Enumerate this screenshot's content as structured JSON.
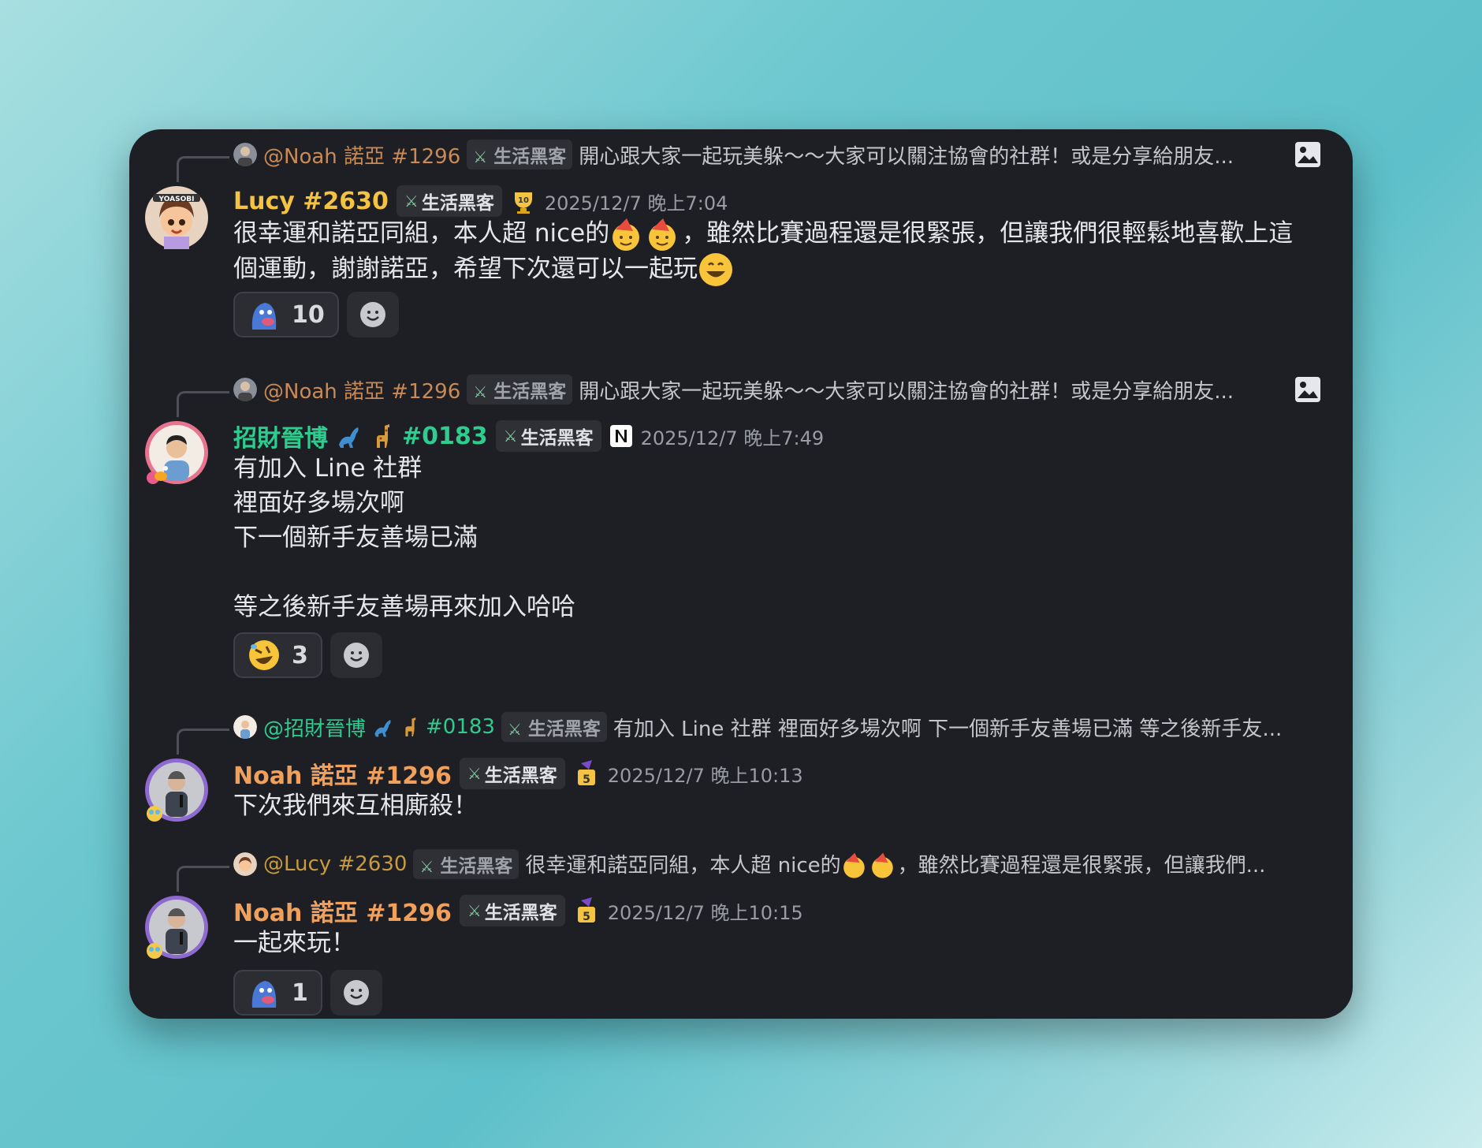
{
  "messages": [
    {
      "reply": {
        "name": "@Noah 諾亞 #1296",
        "badge": "生活黑客",
        "text": "開心跟大家一起玩美躲～～大家可以關注協會的社群！或是分享給朋友..."
      },
      "author": "Lucy #2630",
      "author_color": "#f5c342",
      "badge": "生活黑客",
      "timestamp": "2025/12/7 晚上7:04",
      "body_1": "很幸運和諾亞同組，本人超 nice的",
      "body_2": "，雖然比賽過程還是很緊張，但讓我們很輕鬆地喜歡上這",
      "body_3": "個運動，謝謝諾亞，希望下次還可以一起玩",
      "reaction_count": "10"
    },
    {
      "reply": {
        "name": "@Noah 諾亞 #1296",
        "badge": "生活黑客",
        "text": "開心跟大家一起玩美躲～～大家可以關注協會的社群！或是分享給朋友..."
      },
      "author": "招財晉博",
      "author_tag": "#0183",
      "author_color": "#2ecc8f",
      "badge": "生活黑客",
      "timestamp": "2025/12/7 晚上7:49",
      "body": "有加入 Line 社群\n裡面好多場次啊\n下一個新手友善場已滿\n\n等之後新手友善場再來加入哈哈",
      "reaction_count": "3"
    },
    {
      "reply": {
        "name": "@招財晉博",
        "tag": "#0183",
        "badge": "生活黑客",
        "text": "有加入 Line 社群 裡面好多場次啊 下一個新手友善場已滿  等之後新手友..."
      },
      "author": "Noah 諾亞 #1296",
      "author_color": "#f0a05a",
      "badge": "生活黑客",
      "timestamp": "2025/12/7 晚上10:13",
      "body": "下次我們來互相廝殺！"
    },
    {
      "reply": {
        "name": "@Lucy #2630",
        "badge": "生活黑客",
        "text_1": "很幸運和諾亞同組，本人超 nice的",
        "text_2": "，雖然比賽過程還是很緊張，但讓我們..."
      },
      "author": "Noah 諾亞 #1296",
      "author_color": "#f0a05a",
      "badge": "生活黑客",
      "timestamp": "2025/12/7 晚上10:15",
      "body": "一起來玩！",
      "reaction_count": "1"
    }
  ],
  "icons": {
    "image": "image-icon",
    "add_reaction": "smiley-add-icon",
    "sword": "sword-icon"
  },
  "colors": {
    "card_bg": "#1e1f24",
    "reply_gray": "#c4c6cc"
  }
}
